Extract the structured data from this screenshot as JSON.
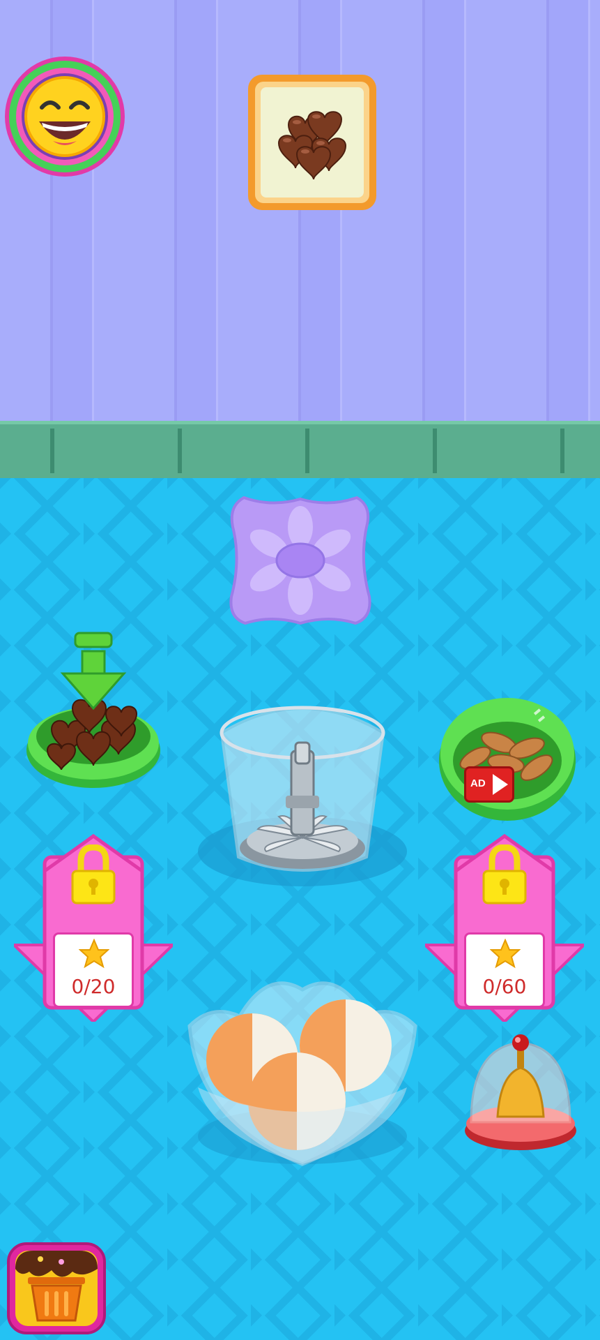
{
  "ingredients": {
    "locked_left": {
      "stars_required": "0/20"
    },
    "locked_right": {
      "stars_required": "0/60"
    },
    "almond_bowl": {
      "ad_badge": "AD"
    }
  },
  "icons": [
    "smiley-face-icon",
    "chocolate-hearts-order-icon",
    "flower-mold-icon",
    "green-down-arrow-icon",
    "chocolate-hearts-bowl-icon",
    "almonds-bowl-icon",
    "ad-video-icon",
    "padlock-icon",
    "star-icon",
    "blender-icon",
    "ice-cream-bowl-icon",
    "service-bell-icon",
    "trash-bin-icon"
  ],
  "colors": {
    "wall": "#a8adfb",
    "trim": "#5bae8f",
    "floor": "#24c2f3",
    "lock_panel": "#f96bd0",
    "counter_text": "#cf2b2b"
  }
}
